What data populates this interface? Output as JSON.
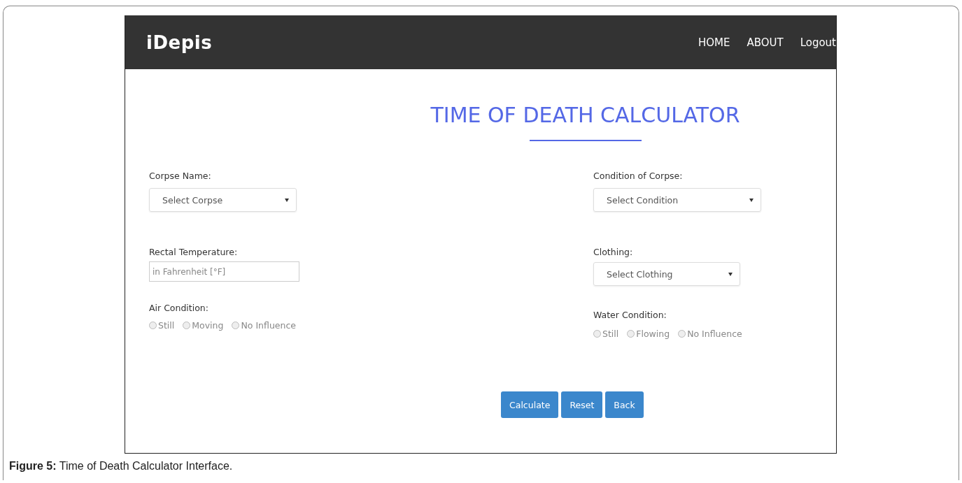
{
  "app": {
    "brand": "iDepis",
    "nav": [
      {
        "label": "HOME"
      },
      {
        "label": "ABOUT"
      },
      {
        "label": "Logout"
      }
    ]
  },
  "title": "TIME OF DEATH CALCULATOR",
  "left_fields": [
    {
      "kind": "select",
      "label": "Corpse Name:",
      "value": "Select Corpse"
    },
    {
      "kind": "input",
      "label": "Rectal Temperature:",
      "placeholder": "in Fahrenheit [°F]"
    },
    {
      "kind": "radios",
      "label": "Air Condition:",
      "options": [
        {
          "label": "Still",
          "selected": false
        },
        {
          "label": "Moving",
          "selected": false
        },
        {
          "label": "No Influence",
          "selected": false
        }
      ]
    }
  ],
  "right_fields": [
    {
      "kind": "select",
      "label": "Condition of Corpse:",
      "value": "Select Condition"
    },
    {
      "kind": "select",
      "label": "Clothing:",
      "value": "Select Clothing"
    },
    {
      "kind": "radios",
      "label": "Water Condition:",
      "options": [
        {
          "label": "Still",
          "selected": false
        },
        {
          "label": "Flowing",
          "selected": false
        },
        {
          "label": "No Influence",
          "selected": false
        }
      ]
    }
  ],
  "buttons": [
    {
      "label": "Calculate"
    },
    {
      "label": "Reset"
    },
    {
      "label": "Back"
    }
  ],
  "caption": {
    "number": "Figure 5:",
    "text": "Time of Death Calculator Interface."
  }
}
